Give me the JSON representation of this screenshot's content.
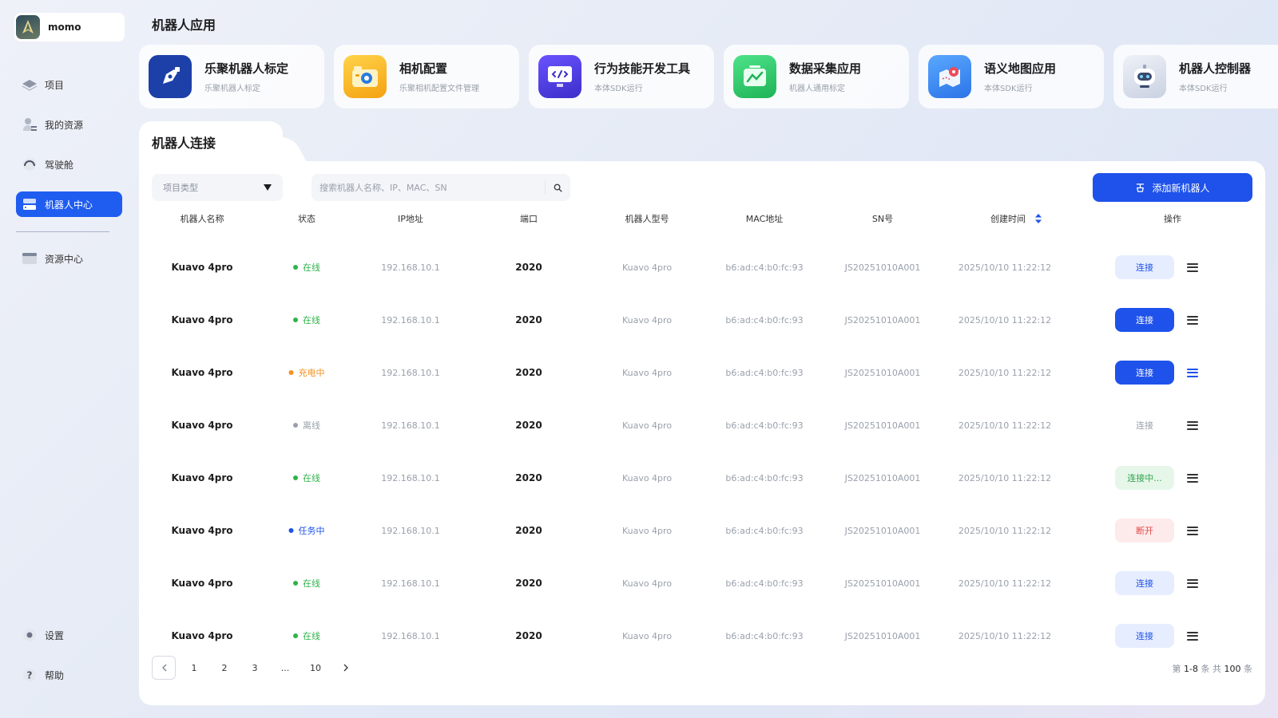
{
  "user": {
    "name": "momo"
  },
  "nav": {
    "items": [
      {
        "label": "项目",
        "icon": "layers-icon"
      },
      {
        "label": "我的资源",
        "icon": "user-resource-icon"
      },
      {
        "label": "驾驶舱",
        "icon": "gauge-icon"
      },
      {
        "label": "机器人中心",
        "icon": "robot-server-icon",
        "active": true
      },
      {
        "label": "资源中心",
        "icon": "folder-icon"
      }
    ],
    "bottom": [
      {
        "label": "设置",
        "icon": "gear-icon"
      },
      {
        "label": "帮助",
        "icon": "help-icon"
      }
    ]
  },
  "apps": {
    "title": "机器人应用",
    "items": [
      {
        "name": "乐聚机器人标定",
        "desc": "乐聚机器人标定",
        "icon": "pen-tool-icon",
        "color": "#1d3fa8"
      },
      {
        "name": "相机配置",
        "desc": "乐聚相机配置文件管理",
        "icon": "camera-icon",
        "color": "#f6b21a"
      },
      {
        "name": "行为技能开发工具",
        "desc": "本体SDK运行",
        "icon": "code-monitor-icon",
        "color": "#5b45e8"
      },
      {
        "name": "数据采集应用",
        "desc": "机器人通用标定",
        "icon": "chart-monitor-icon",
        "color": "#2fcf6a"
      },
      {
        "name": "语义地图应用",
        "desc": "本体SDK运行",
        "icon": "map-pin-icon",
        "color": "#3b8df5"
      },
      {
        "name": "机器人控制器",
        "desc": "本体SDK运行",
        "icon": "robot-head-icon",
        "color": "#c9d1e2"
      }
    ]
  },
  "connection": {
    "title": "机器人连接",
    "filter_placeholder": "项目类型",
    "search_placeholder": "搜索机器人名称、IP、MAC、SN",
    "add_button": "添加新机器人",
    "columns": [
      "机器人名称",
      "状态",
      "IP地址",
      "端口",
      "机器人型号",
      "MAC地址",
      "SN号",
      "创建时间",
      "操作"
    ],
    "rows": [
      {
        "name": "Kuavo 4pro",
        "status": "在线",
        "status_color": "#2fb24a",
        "ip": "192.168.10.1",
        "port": "2020",
        "model": "Kuavo 4pro",
        "mac": "b6:ad:c4:b0:fc:93",
        "sn": "JS20251010A001",
        "created": "2025/10/10 11:22:12",
        "action": "连接",
        "action_style": "light",
        "menu_blue": false
      },
      {
        "name": "Kuavo 4pro",
        "status": "在线",
        "status_color": "#2fb24a",
        "ip": "192.168.10.1",
        "port": "2020",
        "model": "Kuavo 4pro",
        "mac": "b6:ad:c4:b0:fc:93",
        "sn": "JS20251010A001",
        "created": "2025/10/10 11:22:12",
        "action": "连接",
        "action_style": "solid",
        "menu_blue": false
      },
      {
        "name": "Kuavo 4pro",
        "status": "充电中",
        "status_color": "#f5901e",
        "ip": "192.168.10.1",
        "port": "2020",
        "model": "Kuavo 4pro",
        "mac": "b6:ad:c4:b0:fc:93",
        "sn": "JS20251010A001",
        "created": "2025/10/10 11:22:12",
        "action": "连接",
        "action_style": "solid",
        "menu_blue": true
      },
      {
        "name": "Kuavo 4pro",
        "status": "离线",
        "status_color": "#9aa0ab",
        "ip": "192.168.10.1",
        "port": "2020",
        "model": "Kuavo 4pro",
        "mac": "b6:ad:c4:b0:fc:93",
        "sn": "JS20251010A001",
        "created": "2025/10/10 11:22:12",
        "action": "连接",
        "action_style": "plain",
        "menu_blue": false
      },
      {
        "name": "Kuavo 4pro",
        "status": "在线",
        "status_color": "#2fb24a",
        "ip": "192.168.10.1",
        "port": "2020",
        "model": "Kuavo 4pro",
        "mac": "b6:ad:c4:b0:fc:93",
        "sn": "JS20251010A001",
        "created": "2025/10/10 11:22:12",
        "action": "连接中...",
        "action_style": "green",
        "menu_blue": false
      },
      {
        "name": "Kuavo 4pro",
        "status": "任务中",
        "status_color": "#1f52ea",
        "ip": "192.168.10.1",
        "port": "2020",
        "model": "Kuavo 4pro",
        "mac": "b6:ad:c4:b0:fc:93",
        "sn": "JS20251010A001",
        "created": "2025/10/10 11:22:12",
        "action": "断开",
        "action_style": "red",
        "menu_blue": false
      },
      {
        "name": "Kuavo 4pro",
        "status": "在线",
        "status_color": "#2fb24a",
        "ip": "192.168.10.1",
        "port": "2020",
        "model": "Kuavo 4pro",
        "mac": "b6:ad:c4:b0:fc:93",
        "sn": "JS20251010A001",
        "created": "2025/10/10 11:22:12",
        "action": "连接",
        "action_style": "light",
        "menu_blue": false
      },
      {
        "name": "Kuavo 4pro",
        "status": "在线",
        "status_color": "#2fb24a",
        "ip": "192.168.10.1",
        "port": "2020",
        "model": "Kuavo 4pro",
        "mac": "b6:ad:c4:b0:fc:93",
        "sn": "JS20251010A001",
        "created": "2025/10/10 11:22:12",
        "action": "连接",
        "action_style": "light",
        "menu_blue": false
      }
    ]
  },
  "pagination": {
    "pages": [
      "1",
      "2",
      "3",
      "...",
      "10"
    ],
    "info_prefix": "第",
    "range": "1-8",
    "info_mid": "条  共",
    "total": "100",
    "info_suffix": "条"
  },
  "colors": {
    "accent": "#1f52ea"
  }
}
